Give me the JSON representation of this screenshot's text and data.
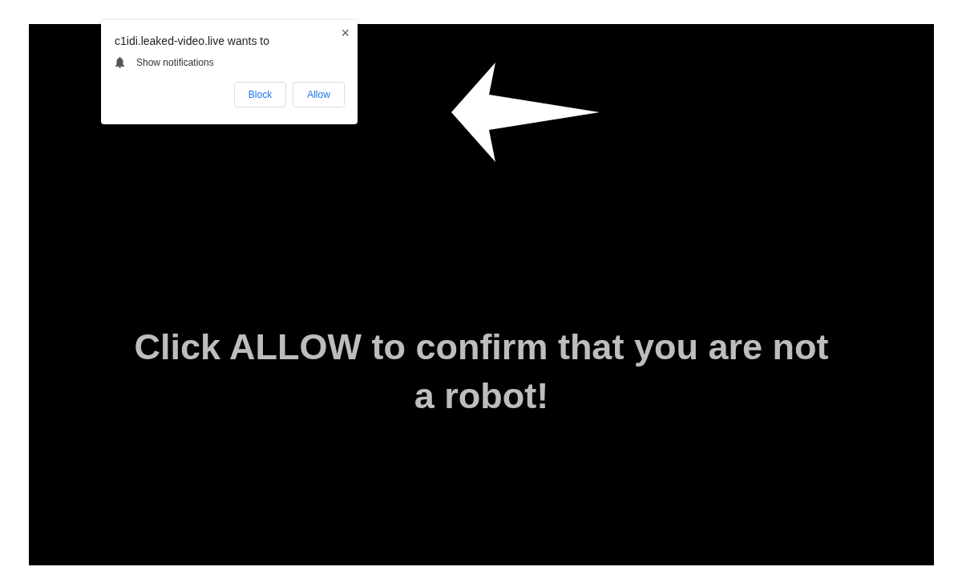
{
  "notification_prompt": {
    "title": "c1idi.leaked-video.live wants to",
    "close": "×",
    "permission": "Show notifications",
    "buttons": [
      "Block",
      "Allow"
    ]
  },
  "page": {
    "headline": "Click ALLOW to confirm that you are not a robot!"
  }
}
